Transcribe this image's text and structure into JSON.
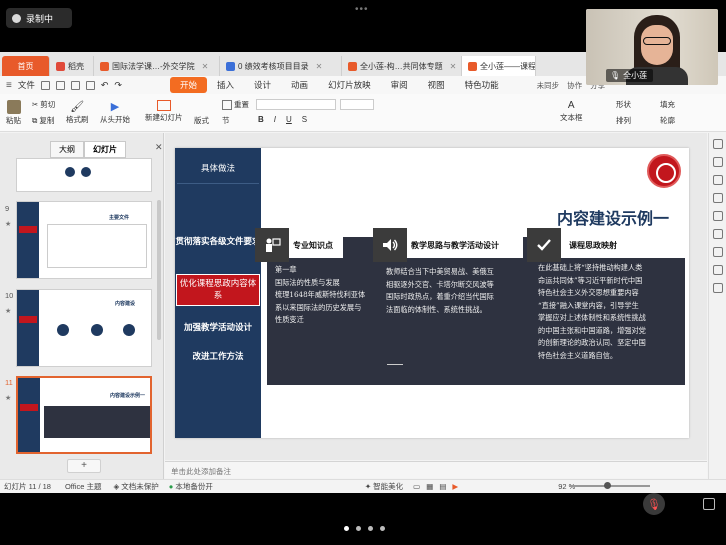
{
  "recording": {
    "label": "录制中"
  },
  "tabs": [
    {
      "label": "首页",
      "kind": "home"
    },
    {
      "label": "稻壳",
      "kind": "normal",
      "color": "#e04a3a"
    },
    {
      "label": "国际法学课…-外交学院",
      "kind": "normal",
      "color": "#e85a2a"
    },
    {
      "label": "0 绩效考核项目目录",
      "kind": "normal",
      "color": "#3b6fd8"
    },
    {
      "label": "全小莲-构…共同体专题",
      "kind": "normal",
      "color": "#e85a2a"
    },
    {
      "label": "全小莲——课程思政",
      "kind": "active",
      "color": "#e85a2a"
    }
  ],
  "menu": {
    "file": "文件",
    "items": [
      "开始",
      "插入",
      "设计",
      "动画",
      "幻灯片放映",
      "审阅",
      "视图",
      "特色功能"
    ],
    "right": [
      "未同步",
      "协作",
      "分享"
    ]
  },
  "ribbon": {
    "paste": "粘贴",
    "cut": "剪切",
    "copy": "复制",
    "format_painter": "格式刷",
    "from_start": "从头开始",
    "new_slide": "新建幻灯片",
    "layout": "版式",
    "section": "节",
    "reset": "重置",
    "textbox": "文本框",
    "shape": "形状",
    "arrange": "排列",
    "fill": "填充",
    "outline": "轮廓"
  },
  "left_panel": {
    "outline_tab": "大纲",
    "slides_tab": "幻灯片",
    "slides": [
      {
        "number": "9",
        "title": "主要文件"
      },
      {
        "number": "10",
        "title": "内容建设"
      },
      {
        "number": "11",
        "title": "内容建设示例一"
      }
    ]
  },
  "slide": {
    "left_items": [
      "具体做法",
      "贯彻落实各级文件要求",
      "优化课程思政内容体系",
      "加强教学活动设计",
      "改进工作方法"
    ],
    "title": "内容建设示例一",
    "columns": [
      {
        "header": "专业知识点",
        "icon": "person-board-icon",
        "lines": [
          "第一章",
          "国际法的性质与发展",
          "梳理1648年威斯特伐利亚体",
          "系以来国际法的历史发展与",
          "性质变迁"
        ]
      },
      {
        "header": "教学思路与教学活动设计",
        "icon": "speaker-icon",
        "lines": [
          "教师结合当下中美贸易战、美俄互",
          "相驱逐外交官、卡塔尔断交风波等",
          "国际时政热点，着重介绍当代国际",
          "法面临的体制性、系统性挑战。"
        ]
      },
      {
        "header": "课程思政映射",
        "icon": "check-icon",
        "lines": [
          "在此基础上将“坚持推动构建人类",
          "命运共同体”等习近平新时代中国",
          "特色社会主义外交思想重要内容",
          "“直接”融入课堂内容，引导学生",
          "掌握应对上述体制性和系统性挑战",
          "的中国主张和中国道路，增强对党",
          "的创新理论的政治认同、坚定中国",
          "特色社会主义道路自信。"
        ]
      }
    ]
  },
  "notes": {
    "placeholder": "单击此处添加备注"
  },
  "status": {
    "slide_count": "幻灯片 11 / 18",
    "theme": "Office 主题",
    "protect": "文档未保护",
    "backup": "本地备份开",
    "smart": "智能美化",
    "zoom": "92 %"
  },
  "webcam": {
    "name": "全小莲"
  }
}
